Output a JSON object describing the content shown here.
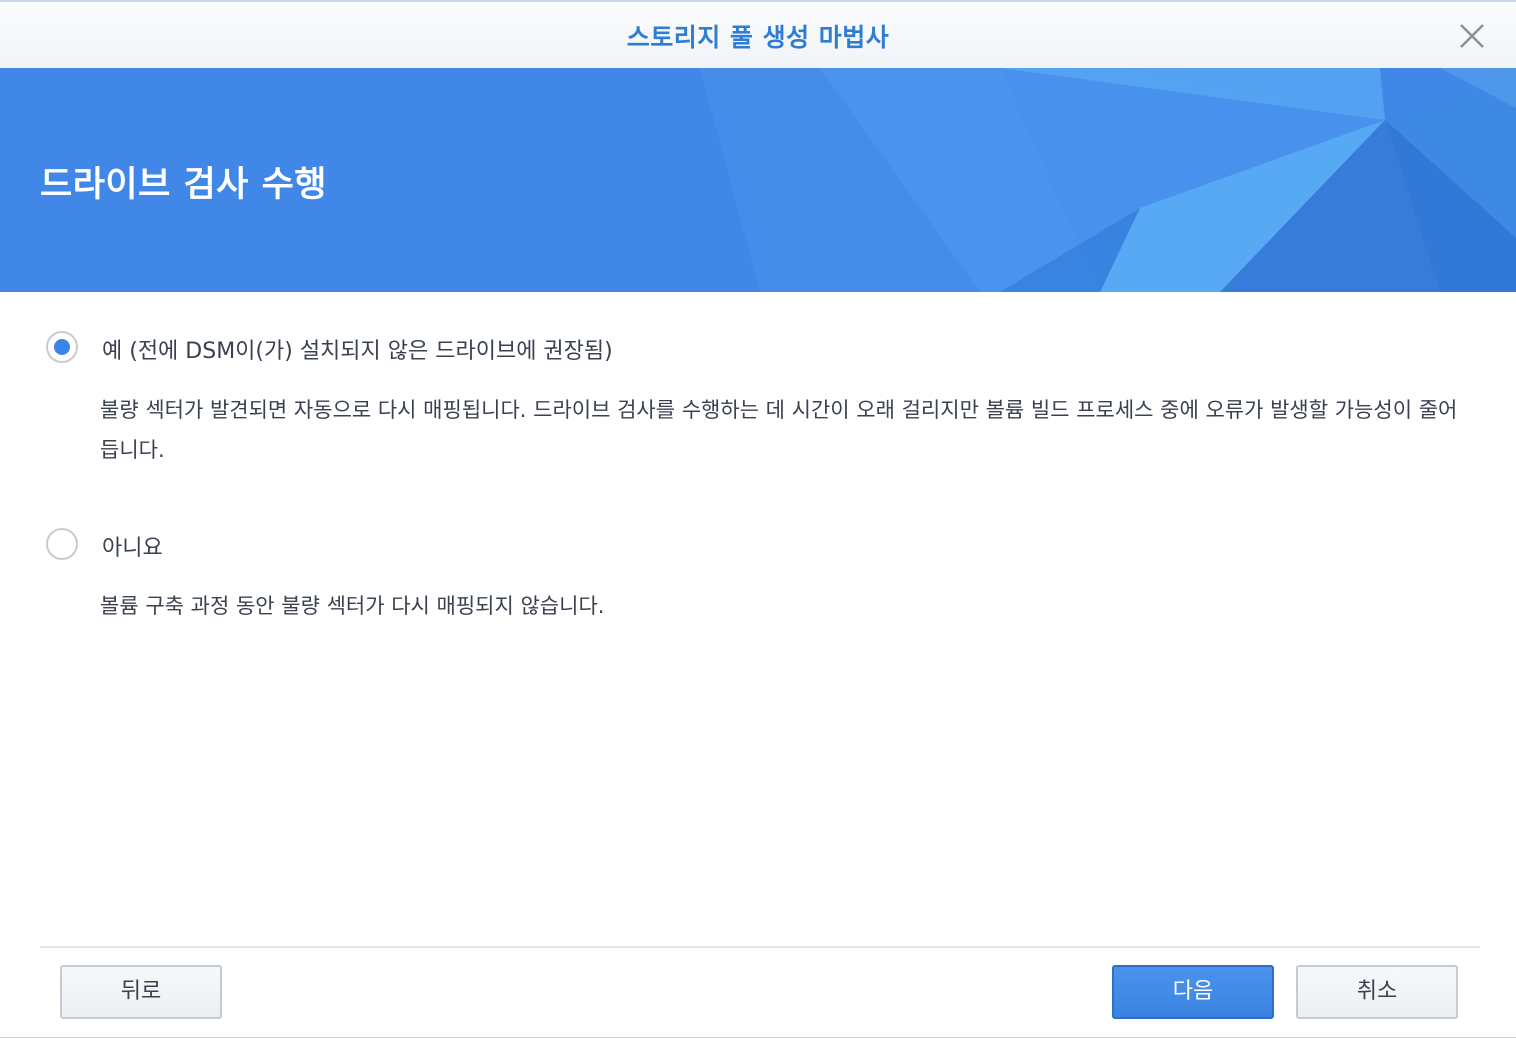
{
  "window": {
    "title": "스토리지 풀 생성 마법사"
  },
  "banner": {
    "title": "드라이브 검사 수행"
  },
  "options": [
    {
      "label": "예 (전에 DSM이(가) 설치되지 않은 드라이브에 권장됨)",
      "description": "불량 섹터가 발견되면 자동으로 다시 매핑됩니다. 드라이브 검사를 수행하는 데 시간이 오래 걸리지만 볼륨 빌드 프로세스 중에 오류가 발생할 가능성이 줄어듭니다.",
      "selected": true
    },
    {
      "label": "아니요",
      "description": "볼륨 구축 과정 동안 불량 섹터가 다시 매핑되지 않습니다.",
      "selected": false
    }
  ],
  "footer": {
    "back_label": "뒤로",
    "next_label": "다음",
    "cancel_label": "취소"
  },
  "colors": {
    "accent": "#3a86e8",
    "title_text": "#2f7dd3",
    "banner_bg": "#3f86e6"
  },
  "icons": {
    "close": "close-icon"
  }
}
